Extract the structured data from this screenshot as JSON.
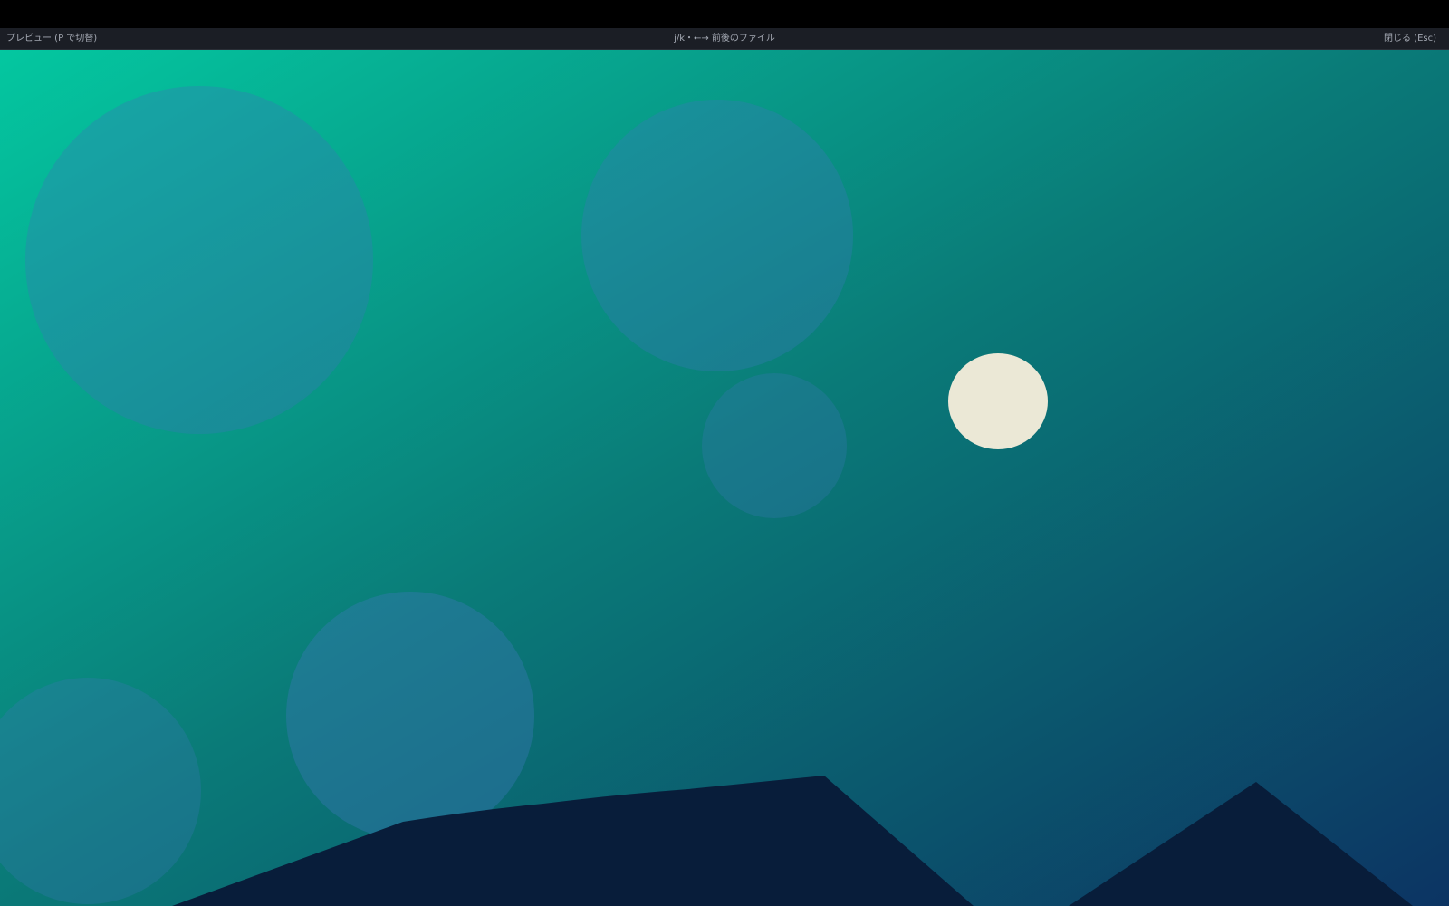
{
  "preview_bar": {
    "left_label": "プレビュー (P で切替)",
    "center_hint": "j/k・←→ 前後のファイル",
    "close_label": "閉じる (Esc)"
  },
  "image": {
    "colors": {
      "gradient_start": "#04c7a0",
      "gradient_mid": "#0a7b78",
      "gradient_end": "#0c3463",
      "bubble": "#3a78b6",
      "moon": "#ebe8d6",
      "mountain": "#081d3a"
    }
  }
}
